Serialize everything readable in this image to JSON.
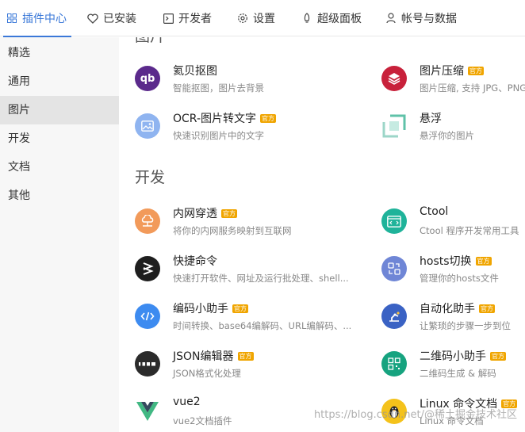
{
  "nav": {
    "tabs": [
      {
        "label": "插件中心",
        "icon": "grid-icon"
      },
      {
        "label": "已安装",
        "icon": "heart-icon"
      },
      {
        "label": "开发者",
        "icon": "terminal-icon"
      },
      {
        "label": "设置",
        "icon": "gear-icon"
      },
      {
        "label": "超级面板",
        "icon": "rocket-icon"
      },
      {
        "label": "帐号与数据",
        "icon": "user-icon"
      }
    ],
    "active_color": "#3a78d8"
  },
  "sidebar": {
    "items": [
      {
        "label": "精选"
      },
      {
        "label": "通用"
      },
      {
        "label": "图片"
      },
      {
        "label": "开发"
      },
      {
        "label": "文档"
      },
      {
        "label": "其他"
      }
    ],
    "active_index": 2
  },
  "main": {
    "section_image_partial": "图片",
    "image_plugins": [
      {
        "name": "氦贝抠图",
        "desc": "智能抠图，图片去背景",
        "icon": "qb-logo-icon",
        "official": false
      },
      {
        "name": "图片压缩",
        "desc": "图片压缩, 支持 JPG、PNG",
        "icon": "layers-icon",
        "official": true,
        "badge": "官方"
      },
      {
        "name": "OCR-图片转文字",
        "desc": "快速识别图片中的文字",
        "icon": "image-icon",
        "official": true,
        "badge": "官方"
      },
      {
        "name": "悬浮",
        "desc": "悬浮你的图片",
        "icon": "float-window-icon",
        "official": false
      }
    ],
    "section_dev": "开发",
    "dev_plugins": [
      {
        "name": "内网穿透",
        "desc": "将你的内网服务映射到互联网",
        "icon": "cloud-network-icon",
        "official": true,
        "badge": "官方"
      },
      {
        "name": "Ctool",
        "desc": "Ctool 程序开发常用工具",
        "icon": "code-window-icon",
        "official": false
      },
      {
        "name": "快捷命令",
        "desc": "快速打开软件、网址及运行批处理、shell...",
        "icon": "bolt-icon",
        "official": false
      },
      {
        "name": "hosts切换",
        "desc": "管理你的hosts文件",
        "icon": "switch-icon",
        "official": true,
        "badge": "官方"
      },
      {
        "name": "编码小助手",
        "desc": "时间转换、base64编解码、URL编解码、...",
        "icon": "code-icon",
        "official": true,
        "badge": "官方"
      },
      {
        "name": "自动化助手",
        "desc": "让繁琐的步骤一步到位",
        "icon": "robot-arm-icon",
        "official": true,
        "badge": "官方"
      },
      {
        "name": "JSON编辑器",
        "desc": "JSON格式化处理",
        "icon": "json-icon",
        "official": true,
        "badge": "官方"
      },
      {
        "name": "二维码小助手",
        "desc": "二维码生成 & 解码",
        "icon": "qrcode-icon",
        "official": true,
        "badge": "官方"
      },
      {
        "name": "vue2",
        "desc": "vue2文档插件",
        "icon": "vue-logo-icon",
        "official": false
      },
      {
        "name": "Linux 命令文档",
        "desc": "Linux 命令文档",
        "icon": "penguin-icon",
        "official": true,
        "badge": "官方"
      }
    ]
  },
  "watermark": "https://blog.csdn.net/@稀土掘金技术社区"
}
